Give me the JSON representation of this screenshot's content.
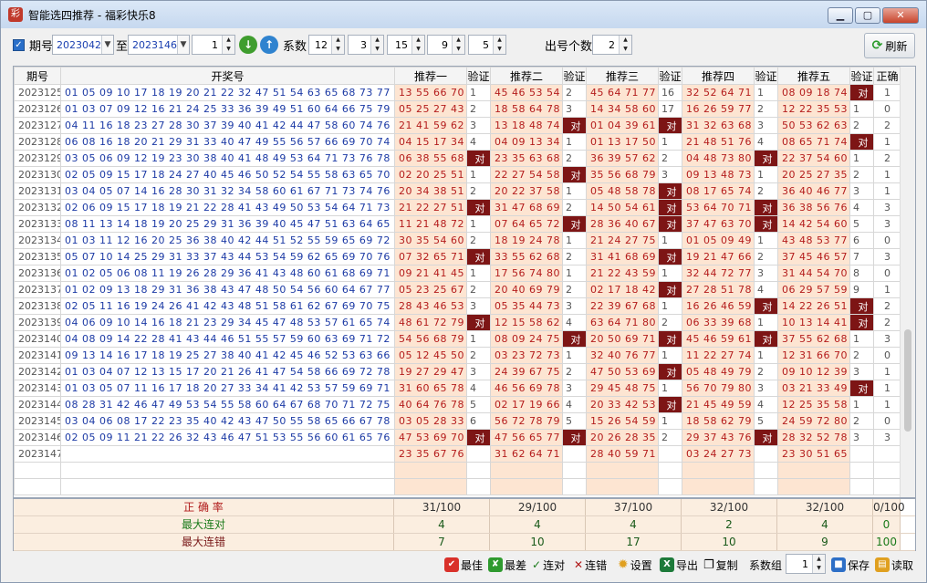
{
  "window": {
    "title": "智能选四推荐 - 福彩快乐8"
  },
  "toolbar": {
    "period_label": "期号",
    "period_from": "2023042",
    "to_label": "至",
    "period_to": "2023146",
    "spin1": "1",
    "coef_label": "系数",
    "coef": [
      "12",
      "3",
      "15",
      "9",
      "5"
    ],
    "count_label": "出号个数",
    "count": "2",
    "refresh_label": "刷新"
  },
  "table": {
    "headers": [
      "期号",
      "开奖号",
      "推荐一",
      "验证",
      "推荐二",
      "验证",
      "推荐三",
      "验证",
      "推荐四",
      "验证",
      "推荐五",
      "验证",
      "正确"
    ],
    "rows": [
      [
        "2023125",
        "01 05 09 10 17 18 19 20 21 22 32 47 51 54 63 65 68 73 77 79",
        "13 55 66 70",
        "1",
        "45 46 53 54",
        "2",
        "45 64 71 77",
        "16",
        "32 52 64 71",
        "1",
        "08 09 18 74",
        "对",
        "1"
      ],
      [
        "2023126",
        "01 03 07 09 12 16 21 24 25 33 36 39 49 51 60 64 66 75 79 80",
        "05 25 27 43",
        "2",
        "18 58 64 78",
        "3",
        "14 34 58 60",
        "17",
        "16 26 59 77",
        "2",
        "12 22 35 53",
        "1",
        "0"
      ],
      [
        "2023127",
        "04 11 16 18 23 27 28 30 37 39 40 41 42 44 47 58 60 74 76 79",
        "21 41 59 62",
        "3",
        "13 18 48 74",
        "对",
        "01 04 39 61",
        "对",
        "31 32 63 68",
        "3",
        "50 53 62 63",
        "2",
        "2"
      ],
      [
        "2023128",
        "06 08 16 18 20 21 29 31 33 40 47 49 55 56 57 66 69 70 74 80",
        "04 15 17 34",
        "4",
        "04 09 13 34",
        "1",
        "01 13 17 50",
        "1",
        "21 48 51 76",
        "4",
        "08 65 71 74",
        "对",
        "1"
      ],
      [
        "2023129",
        "03 05 06 09 12 19 23 30 38 40 41 48 49 53 64 71 73 76 78 80",
        "06 38 55 68",
        "对",
        "23 35 63 68",
        "2",
        "36 39 57 62",
        "2",
        "04 48 73 80",
        "对",
        "22 37 54 60",
        "1",
        "2"
      ],
      [
        "2023130",
        "02 05 09 15 17 18 24 27 40 45 46 50 52 54 55 58 63 65 70 80",
        "02 20 25 51",
        "1",
        "22 27 54 58",
        "对",
        "35 56 68 79",
        "3",
        "09 13 48 73",
        "1",
        "20 25 27 35",
        "2",
        "1"
      ],
      [
        "2023131",
        "03 04 05 07 14 16 28 30 31 32 34 58 60 61 67 71 73 74 76 78",
        "20 34 38 51",
        "2",
        "20 22 37 58",
        "1",
        "05 48 58 78",
        "对",
        "08 17 65 74",
        "2",
        "36 40 46 77",
        "3",
        "1"
      ],
      [
        "2023132",
        "02 06 09 15 17 18 19 21 22 28 41 43 49 50 53 54 64 71 73 77",
        "21 22 27 51",
        "对",
        "31 47 68 69",
        "2",
        "14 50 54 61",
        "对",
        "53 64 70 71",
        "对",
        "36 38 56 76",
        "4",
        "3"
      ],
      [
        "2023133",
        "08 11 13 14 18 19 20 25 29 31 36 39 40 45 47 51 63 64 65 70",
        "11 21 48 72",
        "1",
        "07 64 65 72",
        "对",
        "28 36 40 67",
        "对",
        "37 47 63 70",
        "对",
        "14 42 54 60",
        "5",
        "3"
      ],
      [
        "2023134",
        "01 03 11 12 16 20 25 36 38 40 42 44 51 52 55 59 65 69 72 75",
        "30 35 54 60",
        "2",
        "18 19 24 78",
        "1",
        "21 24 27 75",
        "1",
        "01 05 09 49",
        "1",
        "43 48 53 77",
        "6",
        "0"
      ],
      [
        "2023135",
        "05 07 10 14 25 29 31 33 37 43 44 53 54 59 62 65 69 70 76 77",
        "07 32 65 71",
        "对",
        "33 55 62 68",
        "2",
        "31 41 68 69",
        "对",
        "19 21 47 66",
        "2",
        "37 45 46 57",
        "7",
        "3"
      ],
      [
        "2023136",
        "01 02 05 06 08 11 19 26 28 29 36 41 43 48 60 61 68 69 71 77",
        "09 21 41 45",
        "1",
        "17 56 74 80",
        "1",
        "21 22 43 59",
        "1",
        "32 44 72 77",
        "3",
        "31 44 54 70",
        "8",
        "0"
      ],
      [
        "2023137",
        "01 02 09 13 18 29 31 36 38 43 47 48 50 54 56 60 64 67 77 79",
        "05 23 25 67",
        "2",
        "20 40 69 79",
        "2",
        "02 17 18 42",
        "对",
        "27 28 51 78",
        "4",
        "06 29 57 59",
        "9",
        "1"
      ],
      [
        "2023138",
        "02 05 11 16 19 24 26 41 42 43 48 51 58 61 62 67 69 70 75 77",
        "28 43 46 53",
        "3",
        "05 35 44 73",
        "3",
        "22 39 67 68",
        "1",
        "16 26 46 59",
        "对",
        "14 22 26 51",
        "对",
        "2"
      ],
      [
        "2023139",
        "04 06 09 10 14 16 18 21 23 29 34 45 47 48 53 57 61 65 74 80",
        "48 61 72 79",
        "对",
        "12 15 58 62",
        "4",
        "63 64 71 80",
        "2",
        "06 33 39 68",
        "1",
        "10 13 14 41",
        "对",
        "2"
      ],
      [
        "2023140",
        "04 08 09 14 22 28 41 43 44 46 51 55 57 59 60 63 69 71 72 80",
        "54 56 68 79",
        "1",
        "08 09 24 75",
        "对",
        "20 50 69 71",
        "对",
        "45 46 59 61",
        "对",
        "37 55 62 68",
        "1",
        "3"
      ],
      [
        "2023141",
        "09 13 14 16 17 18 19 25 27 38 40 41 42 45 46 52 53 63 66",
        "05 12 45 50",
        "2",
        "03 23 72 73",
        "1",
        "32 40 76 77",
        "1",
        "11 22 27 74",
        "1",
        "12 31 66 70",
        "2",
        "0"
      ],
      [
        "2023142",
        "01 03 04 07 12 13 15 17 20 21 26 41 47 54 58 66 69 72 78 79",
        "19 27 29 47",
        "3",
        "24 39 67 75",
        "2",
        "47 50 53 69",
        "对",
        "05 48 49 79",
        "2",
        "09 10 12 39",
        "3",
        "1"
      ],
      [
        "2023143",
        "01 03 05 07 11 16 17 18 20 27 33 34 41 42 53 57 59 69 71 77",
        "31 60 65 78",
        "4",
        "46 56 69 78",
        "3",
        "29 45 48 75",
        "1",
        "56 70 79 80",
        "3",
        "03 21 33 49",
        "对",
        "1"
      ],
      [
        "2023144",
        "08 28 31 42 46 47 49 53 54 55 58 60 64 67 68 70 71 72 75 79",
        "40 64 76 78",
        "5",
        "02 17 19 66",
        "4",
        "20 33 42 53",
        "对",
        "21 45 49 59",
        "4",
        "12 25 35 58",
        "1",
        "1"
      ],
      [
        "2023145",
        "03 04 06 08 17 22 23 35 40 42 43 47 50 55 58 65 66 67 78 80",
        "03 05 28 33",
        "6",
        "56 72 78 79",
        "5",
        "15 26 54 59",
        "1",
        "18 58 62 79",
        "5",
        "24 59 72 80",
        "2",
        "0"
      ],
      [
        "2023146",
        "02 05 09 11 21 22 26 32 43 46 47 51 53 55 56 60 61 65 76 78",
        "47 53 69 70",
        "对",
        "47 56 65 77",
        "对",
        "20 26 28 35",
        "2",
        "29 37 43 76",
        "对",
        "28 32 52 78",
        "3",
        "3"
      ],
      [
        "2023147",
        "",
        "23 35 67 76",
        "",
        "31 62 64 71",
        "",
        "28 40 59 71",
        "",
        "03 24 27 73",
        "",
        "23 30 51 65",
        "",
        ""
      ]
    ]
  },
  "stats": {
    "rows": [
      {
        "label": "正 确 率",
        "color": "#b01a1a",
        "vals": [
          "31/100",
          "29/100",
          "37/100",
          "32/100",
          "32/100",
          "0/100"
        ]
      },
      {
        "label": "最大连对",
        "color": "#1a7a1a",
        "vals": [
          "4",
          "4",
          "4",
          "2",
          "4",
          "0"
        ]
      },
      {
        "label": "最大连错",
        "color": "#7a1a1a",
        "vals": [
          "7",
          "10",
          "17",
          "10",
          "9",
          "100"
        ]
      }
    ]
  },
  "bottom": {
    "best": "最佳",
    "worst": "最差",
    "lian_dui": "连对",
    "lian_cuo": "连错",
    "settings": "设置",
    "export": "导出",
    "copy": "复制",
    "coef_group_label": "系数组",
    "coef_group": "1",
    "save": "保存",
    "read": "读取"
  }
}
